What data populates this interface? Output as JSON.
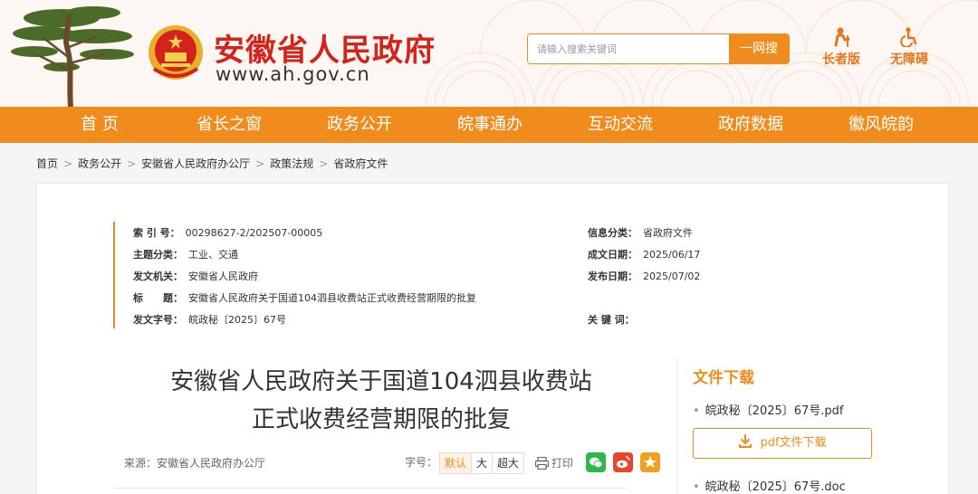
{
  "header": {
    "site_title": "安徽省人民政府",
    "site_url": "www.ah.gov.cn",
    "search_placeholder": "请输入搜索关键词",
    "search_button": "一网搜",
    "tools": [
      {
        "label": "长者版",
        "icon": "elder-icon"
      },
      {
        "label": "无障碍",
        "icon": "wheelchair-icon"
      }
    ]
  },
  "nav": {
    "items": [
      "首 页",
      "省长之窗",
      "政务公开",
      "皖事通办",
      "互动交流",
      "政府数据",
      "徽风皖韵"
    ]
  },
  "breadcrumb": [
    "首页",
    "政务公开",
    "安徽省人民政府办公厅",
    "政策法规",
    "省政府文件"
  ],
  "meta": {
    "index_label": "索 引 号：",
    "index_value": "00298627-2/202507-00005",
    "topic_label": "主题分类：",
    "topic_value": "工业、交通",
    "issuer_label": "发文机关：",
    "issuer_value": "安徽省人民政府",
    "title_label": "标　　题：",
    "title_value": "安徽省人民政府关于国道104泗县收费站正式收费经营期限的批复",
    "docno_label": "发文字号：",
    "docno_value": "皖政秘〔2025〕67号",
    "category_label": "信息分类：",
    "category_value": "省政府文件",
    "created_label": "成文日期：",
    "created_value": "2025/06/17",
    "published_label": "发布日期：",
    "published_value": "2025/07/02",
    "keywords_label": "关 键 词："
  },
  "document": {
    "title_line1": "安徽省人民政府关于国道104泗县收费站",
    "title_line2": "正式收费经营期限的批复",
    "source": "来源：安徽省人民政府办公厅",
    "fontsize_label": "字号：",
    "fontsize_options": [
      "默认",
      "大",
      "超大"
    ],
    "print_label": "打印"
  },
  "downloads": {
    "title": "文件下载",
    "files": [
      "皖政秘〔2025〕67号.pdf",
      "皖政秘〔2025〕67号.doc"
    ],
    "pdf_button": "pdf文件下载"
  },
  "colors": {
    "accent": "#f08c1e",
    "brand_red": "#d4231a"
  }
}
